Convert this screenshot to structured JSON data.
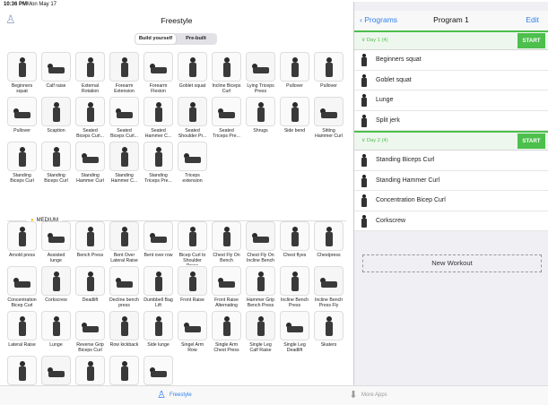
{
  "status": {
    "time": "10:36 PM",
    "date": "Mon May 17"
  },
  "left": {
    "title": "Freestyle",
    "segments": [
      "Build yourself",
      "Pre-built"
    ],
    "easy_items": [
      "Beginners squat",
      "Calf raise",
      "External Rotation",
      "Forearm Extension",
      "Forearm Flexion",
      "Goblet squat",
      "Incline Biceps Curl",
      "Lying Triceps Press",
      "Pullover",
      "Pullover",
      "Pullover",
      "Scaption",
      "Seated Biceps Curl...",
      "Seated Biceps Curl...",
      "Seated Hammer C...",
      "Seated Shoulder Pr...",
      "Seated Triceps Pre...",
      "Shrugs",
      "Side bend",
      "Sitting Hammer Curl",
      "Standing Biceps Curl",
      "Standing Biceps Curl",
      "Standing Hammer Curl",
      "Standing Hammer C...",
      "Standing Triceps Pre...",
      "Triceps extension"
    ],
    "section_medium": "MEDIUM",
    "medium_items": [
      "Arnold press",
      "Assisted lunge",
      "Bench Press",
      "Bent Over Lateral Raise",
      "Bent over row",
      "Bicep Curl to Shoulder Press",
      "Chest Fly On Bench",
      "Chest Fly On Incline Bench",
      "Chest flyes",
      "Chestpress",
      "Concentration Bicep Curl",
      "Corkscrew",
      "Deadlift",
      "Decline bench press",
      "Dumbbell Bag Lift",
      "Front Raise",
      "Front Raise Alternating",
      "Hammer Grip Bench Press",
      "Incline Bench Press",
      "Incline Bench Press Fly",
      "Lateral Raise",
      "Lunge",
      "Reverse Grip Biceps Curl",
      "Row kickback",
      "Side lunge",
      "Singel Arm Row",
      "Single Arm Chest Press",
      "Single Leg Calf Raise",
      "Single Leg Deadlift",
      "Skaters",
      "",
      "",
      "",
      "",
      ""
    ]
  },
  "right": {
    "back_label": "Programs",
    "title": "Program 1",
    "edit_label": "Edit",
    "day1": {
      "label": "Day 1 (4)",
      "start": "START",
      "exercises": [
        "Beginners squat",
        "Goblet squat",
        "Lunge",
        "Split jerk"
      ]
    },
    "day2": {
      "label": "Day 2 (4)",
      "start": "START",
      "exercises": [
        "Standing Biceps Curl",
        "Standing Hammer Curl",
        "Concentration Bicep Curl",
        "Corkscrew"
      ]
    },
    "new_workout": "New Workout"
  },
  "tabbar": {
    "freestyle": "Freestyle",
    "more": "More Apps"
  },
  "colors": {
    "accent": "#2f80ed",
    "start_green": "#4cbf4c",
    "medium_star": "#f2c11d"
  }
}
